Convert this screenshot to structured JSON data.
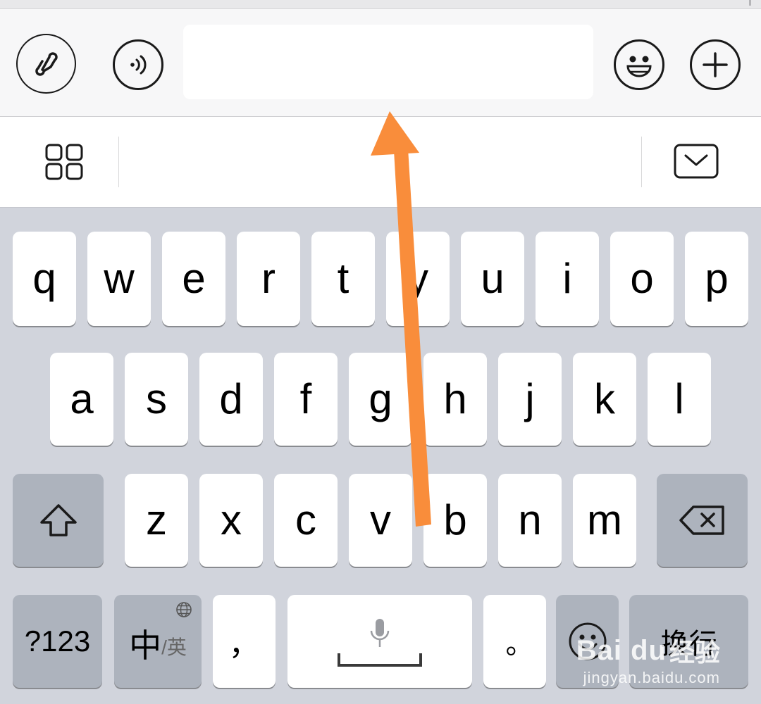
{
  "chat_bar": {
    "input_value": "",
    "input_placeholder": ""
  },
  "toolbar": {
    "icons": [
      "apps-grid-icon",
      "collapse-keyboard-icon"
    ]
  },
  "keyboard": {
    "row1": [
      "q",
      "w",
      "e",
      "r",
      "t",
      "y",
      "u",
      "i",
      "o",
      "p"
    ],
    "row2": [
      "a",
      "s",
      "d",
      "f",
      "g",
      "h",
      "j",
      "k",
      "l"
    ],
    "row3": [
      "z",
      "x",
      "c",
      "v",
      "b",
      "n",
      "m"
    ],
    "symbols_label": "?123",
    "lang_main": "中",
    "lang_alt": "/英",
    "comma": "，",
    "period": "。",
    "return_label": "换行"
  },
  "watermark": {
    "brand": "Bai du",
    "brand_cn": "经验",
    "url": "jingyan.baidu.com"
  },
  "colors": {
    "keyboard_bg": "#d1d4dc",
    "key_light": "#ffffff",
    "key_dark": "#adb3bd",
    "annotation_arrow": "#f98d3b"
  }
}
